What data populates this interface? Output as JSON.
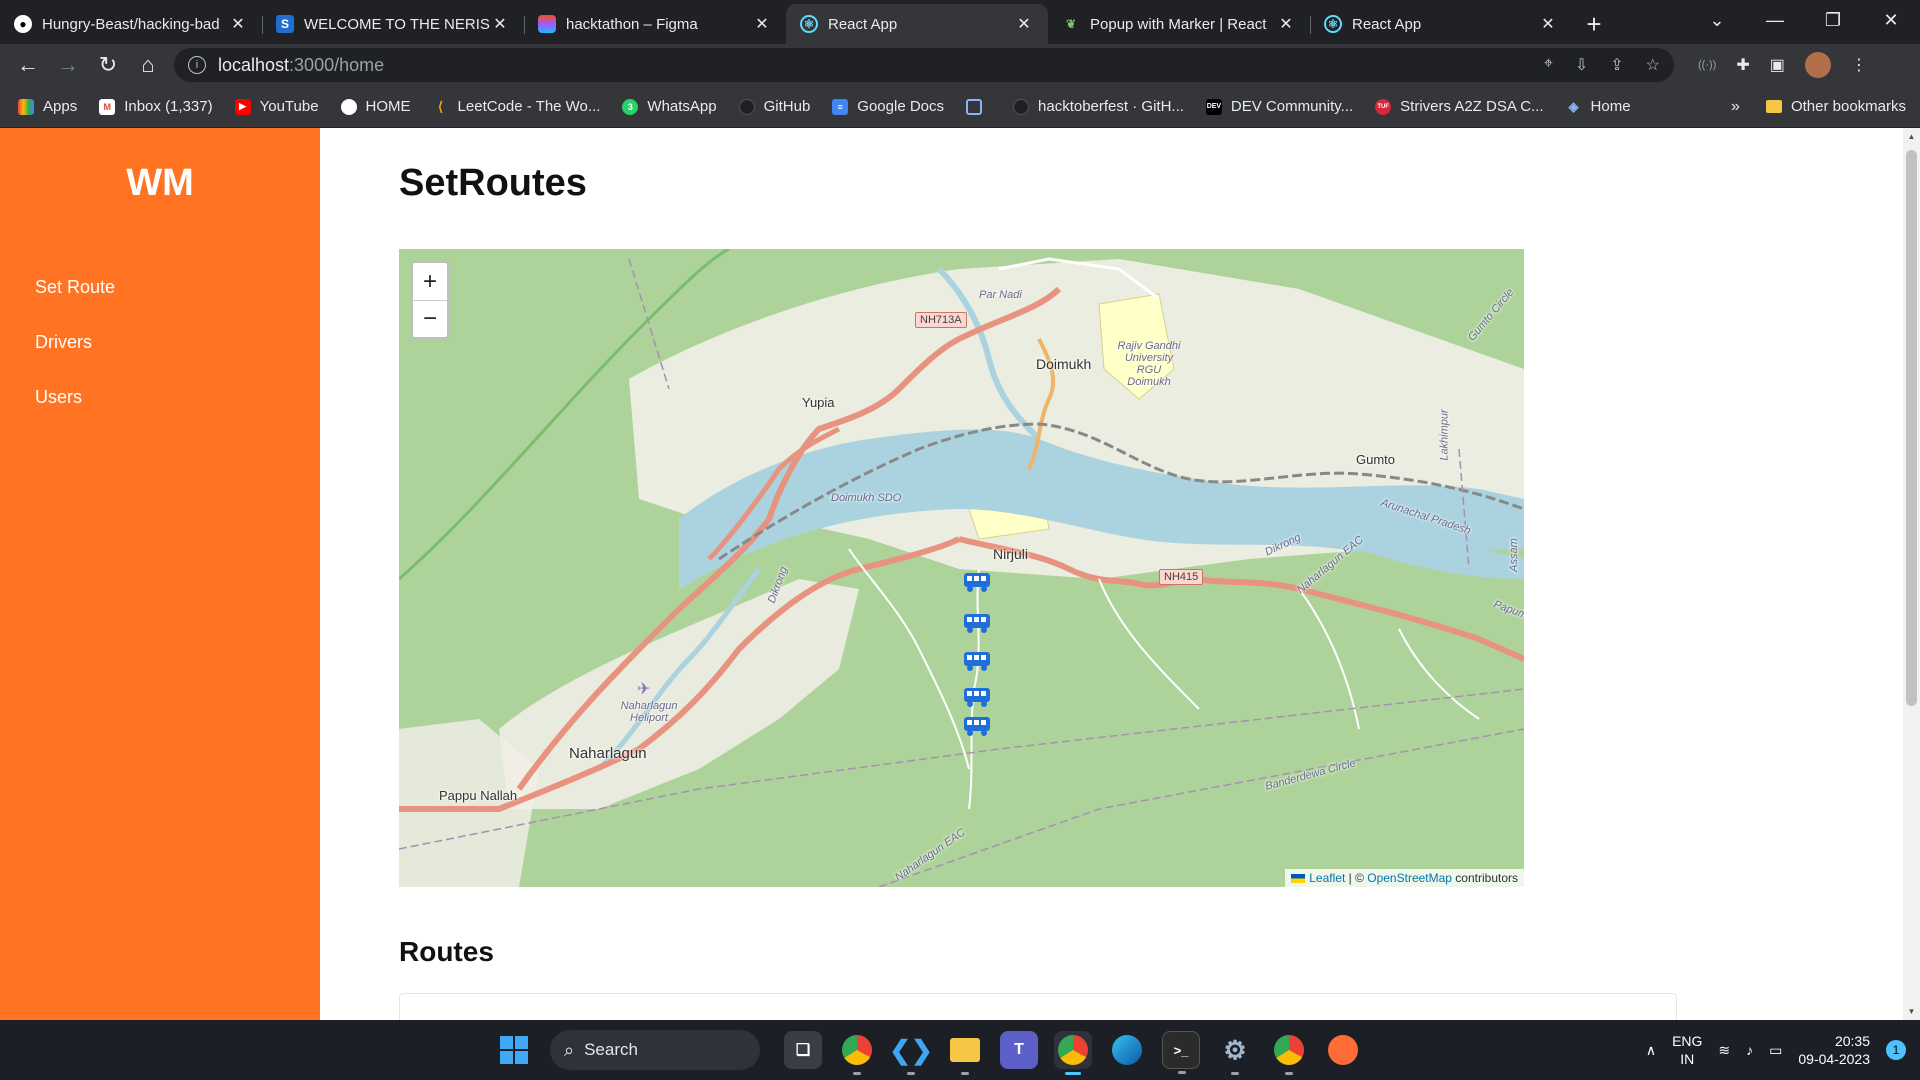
{
  "browser": {
    "tabs": [
      {
        "title": "Hungry-Beast/hacking-bad",
        "icon": "github-icon"
      },
      {
        "title": "WELCOME TO THE NERIST",
        "icon": "s-logo-icon"
      },
      {
        "title": "hacktathon – Figma",
        "icon": "figma-icon"
      },
      {
        "title": "React App",
        "icon": "react-icon",
        "active": true
      },
      {
        "title": "Popup with Marker | React",
        "icon": "leaf-icon"
      },
      {
        "title": "React App",
        "icon": "react-icon"
      }
    ],
    "url_host": "localhost",
    "url_path": ":3000/home",
    "bookmarks": [
      {
        "label": "Apps"
      },
      {
        "label": "Inbox (1,337)"
      },
      {
        "label": "YouTube"
      },
      {
        "label": "HOME"
      },
      {
        "label": "LeetCode - The Wo..."
      },
      {
        "label": "WhatsApp"
      },
      {
        "label": "GitHub"
      },
      {
        "label": "Google Docs"
      },
      {
        "label": ""
      },
      {
        "label": "hacktoberfest · GitH..."
      },
      {
        "label": "DEV Community..."
      },
      {
        "label": "Strivers A2Z DSA C..."
      },
      {
        "label": "Home"
      }
    ],
    "other_bookmarks": "Other bookmarks",
    "more": "»"
  },
  "sidebar": {
    "brand": "WM",
    "items": [
      {
        "label": "Set Route"
      },
      {
        "label": "Drivers"
      },
      {
        "label": "Users"
      }
    ]
  },
  "main": {
    "title": "SetRoutes",
    "routes_heading": "Routes"
  },
  "map": {
    "zoom_in": "+",
    "zoom_out": "−",
    "attribution": {
      "leaflet": "Leaflet",
      "sep": " | © ",
      "osm": "OpenStreetMap",
      "suffix": " contributors"
    },
    "places": {
      "doimukh": "Doimukh",
      "yupia": "Yupia",
      "nirjuli": "Nirjuli",
      "gumto": "Gumto",
      "naharlagun": "Naharlagun",
      "pappu_nallah": "Pappu Nallah",
      "rgu": "Rajiv Gandhi University RGU Doimukh",
      "doimukh_sdo": "Doimukh SDO",
      "heliport": "Naharlagun Heliport",
      "arunachal": "Arunachal Pradesh",
      "par_nadi": "Par Nadi",
      "dikrong": "Dikrong",
      "banderdewa": "Banderdewa Circle",
      "naharlagun_eac": "Naharlagun EAC",
      "gumto_circle": "Gumto Circle",
      "assam": "Assam",
      "papum": "Papum",
      "lekhimpur": "Lakhimpur"
    },
    "shields": {
      "nh713a": "NH713A",
      "nh415": "NH415"
    },
    "markers": [
      {
        "type": "bus",
        "label": "bus-marker"
      },
      {
        "type": "bus",
        "label": "bus-marker"
      },
      {
        "type": "bus",
        "label": "bus-marker"
      },
      {
        "type": "bus",
        "label": "bus-marker"
      },
      {
        "type": "bus",
        "label": "bus-marker"
      }
    ]
  },
  "taskbar": {
    "search_label": "Search",
    "lang_top": "ENG",
    "lang_bottom": "IN",
    "time": "20:35",
    "date": "09-04-2023",
    "notifications": "1"
  },
  "colors": {
    "sidebar": "#ff7322",
    "map_land": "#aed39a",
    "river": "#aad3df",
    "road": "#e8937f"
  }
}
